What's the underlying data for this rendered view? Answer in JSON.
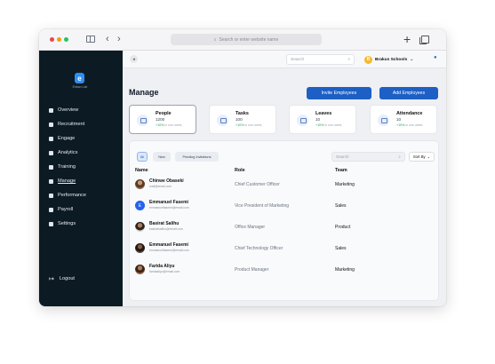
{
  "browser": {
    "url_placeholder": "Search or enter website name",
    "back_glyph": "‹",
    "forward_glyph": "›",
    "new_tab_glyph": "+"
  },
  "sidebar": {
    "logo_glyph": "e",
    "logo_text": "Erikan Lab",
    "items": [
      {
        "label": "Overview",
        "icon": "overview-icon"
      },
      {
        "label": "Recruitment",
        "icon": "recruitment-icon"
      },
      {
        "label": "Engage",
        "icon": "engage-icon"
      },
      {
        "label": "Analytics",
        "icon": "analytics-icon"
      },
      {
        "label": "Training",
        "icon": "training-icon"
      },
      {
        "label": "Manage",
        "icon": "manage-icon",
        "active": true
      },
      {
        "label": "Performance",
        "icon": "performance-icon"
      },
      {
        "label": "Payroll",
        "icon": "payroll-icon"
      },
      {
        "label": "Settings",
        "icon": "settings-icon"
      }
    ],
    "logout_label": "Logout"
  },
  "topbar": {
    "search_placeholder": "Search",
    "school_initial": "B",
    "school_name": "Brakus Schools"
  },
  "page": {
    "title": "Manage",
    "invite_button": "Invite Employees",
    "add_button": "Add Employees"
  },
  "stats": [
    {
      "title": "People",
      "value": "1200",
      "trend": "+10%",
      "period": "in one week"
    },
    {
      "title": "Tasks",
      "value": "100",
      "trend": "+10%",
      "period": "in one week"
    },
    {
      "title": "Leaves",
      "value": "10",
      "trend": "+10%",
      "period": "in one week"
    },
    {
      "title": "Attendance",
      "value": "10",
      "trend": "+10%",
      "period": "in one week"
    }
  ],
  "table": {
    "filters": [
      "All",
      "New",
      "Pending Invitations"
    ],
    "active_filter": "All",
    "search_placeholder": "Search",
    "sort_label": "Sort By",
    "headers": {
      "name": "Name",
      "role": "Role",
      "team": "Team"
    },
    "rows": [
      {
        "name": "Chinwe Obaseki",
        "email": "mail@email.com",
        "role": "Chief Customer Officer",
        "team": "Marketing",
        "avatar": "photo"
      },
      {
        "name": "Emmanuel Fasemi",
        "email": "emmanuelfasemi@email.com",
        "role": "Vice President of Marketing",
        "team": "Sales",
        "avatar": "initial",
        "initial": "E"
      },
      {
        "name": "Basirat Salihu",
        "email": "basiratsalihu@email.com",
        "role": "Office Manager",
        "team": "Product",
        "avatar": "photo"
      },
      {
        "name": "Emmanuel Fasemi",
        "email": "emmanuelfasemi@email.com",
        "role": "Chief Technology Officer",
        "team": "Sales",
        "avatar": "photo"
      },
      {
        "name": "Farida Aliyu",
        "email": "faridaaliyu@email.com",
        "role": "Product Manager",
        "team": "Marketing",
        "avatar": "photo"
      }
    ]
  },
  "colors": {
    "sidebar_bg": "#0c1a24",
    "primary": "#1d5fc4",
    "trend_up": "#16a34a"
  }
}
